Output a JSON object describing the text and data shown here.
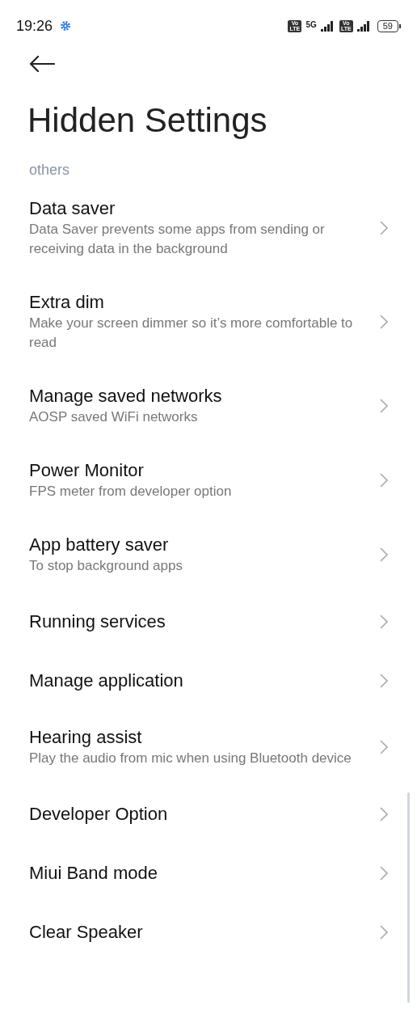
{
  "status_bar": {
    "time": "19:26",
    "sims": [
      {
        "badge_top": "Vo",
        "badge_bottom": "LTE",
        "network": "5G"
      },
      {
        "badge_top": "Vo",
        "badge_bottom": "LTE"
      }
    ],
    "battery": "59"
  },
  "title": "Hidden Settings",
  "section": "others",
  "items": [
    {
      "title": "Data saver",
      "subtitle": "Data Saver prevents some apps from sending or receiving data in the background"
    },
    {
      "title": "Extra dim",
      "subtitle": "Make your screen dimmer so it’s more comfortable to read"
    },
    {
      "title": "Manage saved networks",
      "subtitle": "AOSP saved WiFi networks"
    },
    {
      "title": "Power Monitor",
      "subtitle": "FPS meter from developer option"
    },
    {
      "title": "App battery saver",
      "subtitle": "To stop background apps"
    },
    {
      "title": "Running services"
    },
    {
      "title": "Manage application"
    },
    {
      "title": "Hearing assist",
      "subtitle": "Play the audio from mic when using Bluetooth device"
    },
    {
      "title": "Developer Option"
    },
    {
      "title": "Miui Band mode"
    },
    {
      "title": "Clear Speaker"
    }
  ]
}
